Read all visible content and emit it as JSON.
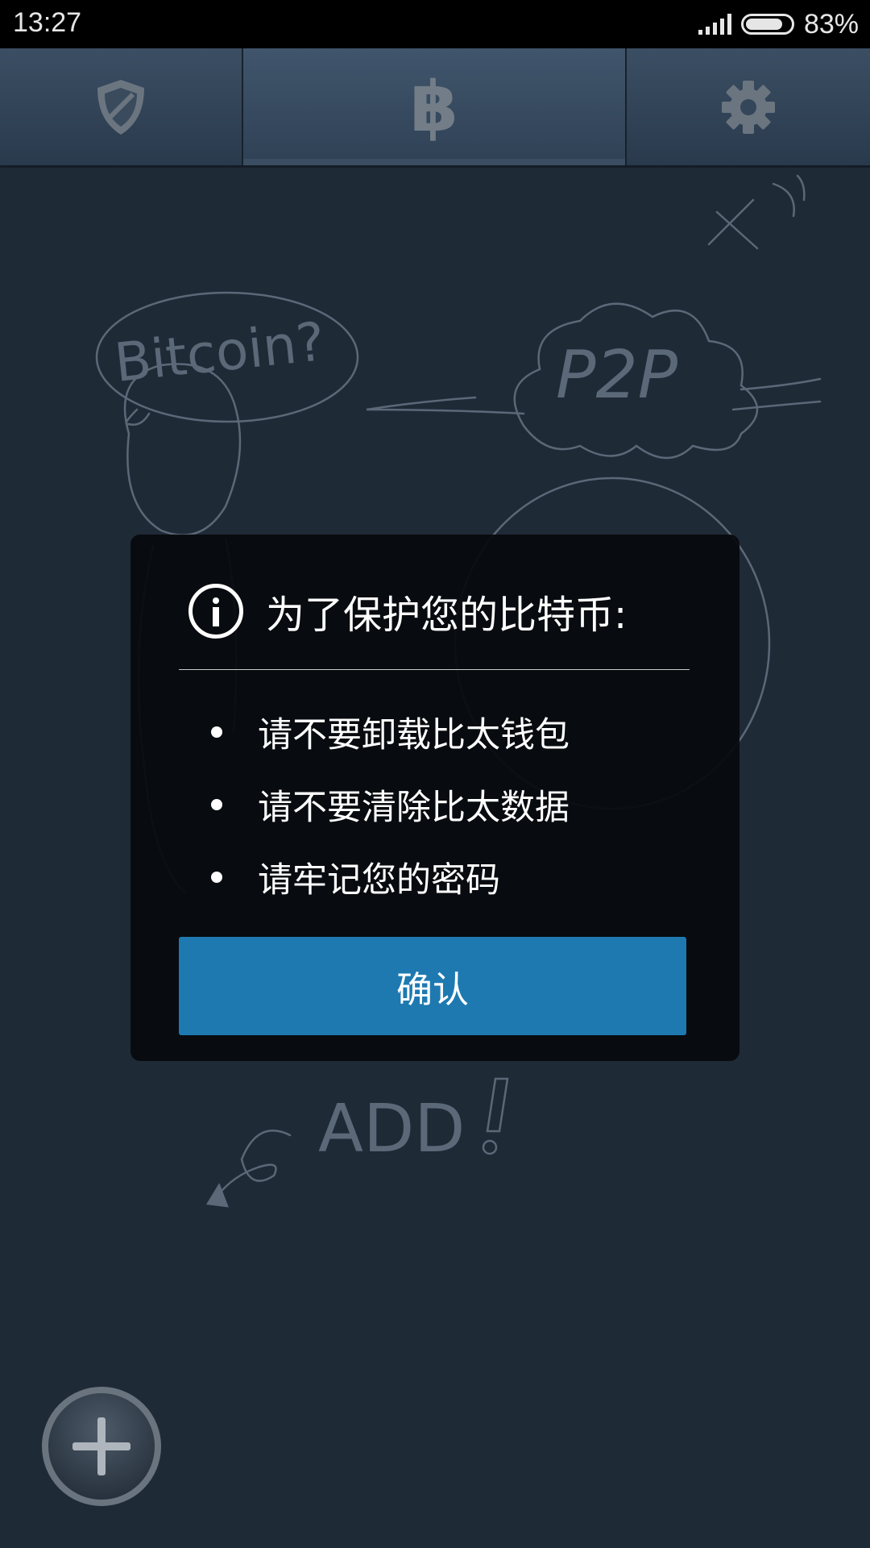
{
  "status_bar": {
    "time": "13:27",
    "battery_percent": "83%",
    "battery_level": 0.83,
    "signal_bars": 5
  },
  "tabs": [
    {
      "name": "security",
      "icon": "shield-icon"
    },
    {
      "name": "wallet",
      "icon": "bitcoin-icon",
      "glyph": "฿",
      "selected": true
    },
    {
      "name": "settings",
      "icon": "gear-icon"
    }
  ],
  "background_doodles": {
    "bubble_text": "Bitcoin?",
    "cloud_text": "P2P",
    "add_hint": "ADD"
  },
  "dialog": {
    "title": "为了保护您的比特币:",
    "icon": "info-icon",
    "items": [
      "请不要卸载比太钱包",
      "请不要清除比太数据",
      "请牢记您的密码"
    ],
    "confirm_label": "确认"
  },
  "fab": {
    "icon": "plus-icon"
  },
  "colors": {
    "background": "#1f2a37",
    "tab_bar": "#34465a",
    "dialog": "#06090c",
    "confirm_button": "#1e79b1"
  }
}
